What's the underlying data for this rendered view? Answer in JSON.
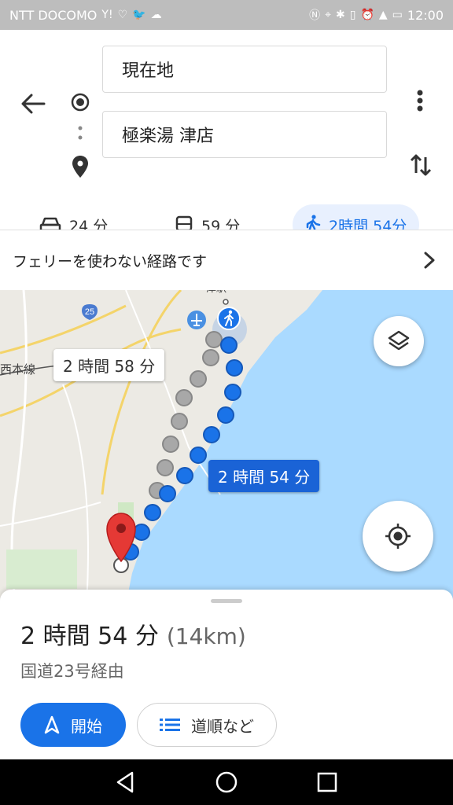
{
  "status_bar": {
    "carrier": "NTT DOCOMO",
    "left_icons": [
      "yahoo-icon",
      "heartbeat-icon",
      "twitter-icon",
      "cloud-icon"
    ],
    "right_icons": [
      "nfc-icon",
      "location-icon",
      "bluetooth-icon",
      "vibrate-icon",
      "alarm-icon",
      "signal-4g-icon",
      "battery-icon"
    ],
    "time": "12:00"
  },
  "directions": {
    "origin": "現在地",
    "destination": "極楽湯 津店"
  },
  "modes": [
    {
      "icon": "car-icon",
      "label": "24 分"
    },
    {
      "icon": "bus-icon",
      "label": "59 分"
    },
    {
      "icon": "walk-icon",
      "label": "2時間 54分",
      "active": true
    }
  ],
  "ferry_notice": "フェリーを使わない経路です",
  "map": {
    "route_labels": {
      "alternate": "2 時間 58 分",
      "selected": "2 時間 54 分"
    },
    "road_label": "25",
    "place_label": "西本線",
    "partial_label": "津駅",
    "colors": {
      "selected_route": "#1a73e8",
      "alternate_route": "#9e9e9e",
      "sea": "#aadaff",
      "land": "#eceae4",
      "destination_pin": "#e53935"
    }
  },
  "sheet": {
    "duration": "2 時間 54 分",
    "distance": "(14km)",
    "via": "国道23号経由",
    "start_label": "開始",
    "steps_label": "道順など"
  },
  "nav_bar": [
    "back-icon",
    "home-icon",
    "recents-icon"
  ]
}
